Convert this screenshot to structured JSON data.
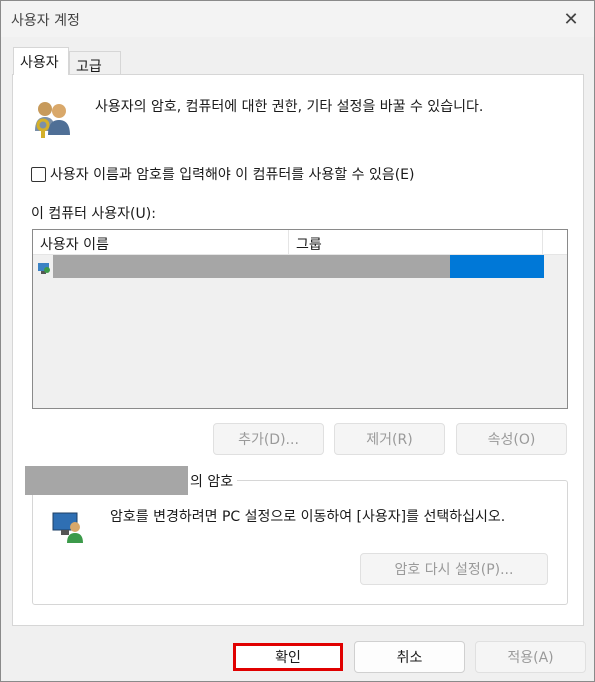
{
  "window": {
    "title": "사용자 계정",
    "close_glyph": "✕"
  },
  "tabs": [
    {
      "label": "사용자",
      "active": true
    },
    {
      "label": "고급",
      "active": false
    }
  ],
  "users_tab": {
    "intro": "사용자의 암호, 컴퓨터에 대한 권한, 기타 설정을 바꿀 수 있습니다.",
    "checkbox_label": "사용자 이름과 암호를 입력해야 이 컴퓨터를 사용할 수 있음(E)",
    "checkbox_checked": false,
    "list_label": "이 컴퓨터 사용자(U):",
    "columns": [
      "사용자 이름",
      "그룹"
    ],
    "buttons": {
      "add": "추가(D)...",
      "remove": "제거(R)",
      "properties": "속성(O)"
    }
  },
  "password_group": {
    "legend_suffix": "의 암호",
    "description": "암호를 변경하려면 PC 설정으로 이동하여 [사용자]를 선택하십시오.",
    "reset_button": "암호 다시 설정(P)..."
  },
  "footer": {
    "ok": "확인",
    "cancel": "취소",
    "apply": "적용(A)"
  },
  "colors": {
    "selection": "#0078d7",
    "redaction": "#a6a6a6",
    "highlight_border": "#e00000"
  },
  "icons": {
    "users": "users-keys-icon",
    "row_user": "user-row-icon",
    "password": "user-monitor-icon"
  }
}
